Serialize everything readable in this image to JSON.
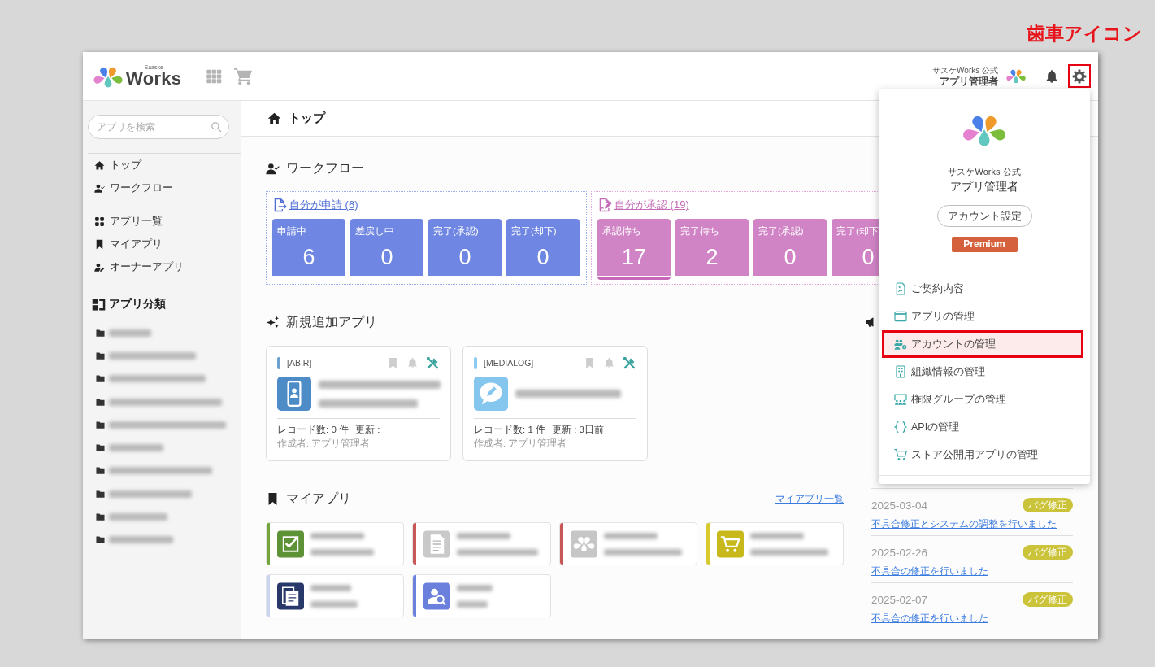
{
  "annotation": {
    "label": "歯車アイコン"
  },
  "header": {
    "logo": {
      "small": "Saaske",
      "name": "Works"
    },
    "account": {
      "org": "サスケWorks 公式",
      "role": "アプリ管理者"
    },
    "settings_button": {
      "annotated": true
    }
  },
  "sidebar": {
    "search": {
      "placeholder": "アプリを検索"
    },
    "nav_groups": [
      {
        "items": [
          {
            "kind": "home",
            "label": "トップ"
          },
          {
            "kind": "workflow",
            "label": "ワークフロー"
          }
        ]
      },
      {
        "items": [
          {
            "kind": "apps",
            "label": "アプリ一覧"
          },
          {
            "kind": "bookmark",
            "label": "マイアプリ"
          },
          {
            "kind": "owner",
            "label": "オーナーアプリ"
          }
        ]
      }
    ],
    "categories": {
      "title": "アプリ分類",
      "items": [
        {
          "kind": "folder"
        },
        {
          "kind": "folder"
        },
        {
          "kind": "folder"
        },
        {
          "kind": "folder"
        },
        {
          "kind": "folder"
        },
        {
          "kind": "folder"
        },
        {
          "kind": "folder"
        },
        {
          "kind": "folder"
        },
        {
          "kind": "folder"
        },
        {
          "kind": "folder"
        }
      ]
    }
  },
  "page_title": "トップ",
  "workflow": {
    "title": "ワークフロー",
    "groups": [
      {
        "kind": "request",
        "link": "自分が申請 (6)",
        "tiles": [
          {
            "label": "申請中",
            "value": "6",
            "selected": false
          },
          {
            "label": "差戻し中",
            "value": "0",
            "selected": false
          },
          {
            "label": "完了(承認)",
            "value": "0",
            "selected": false
          },
          {
            "label": "完了(却下)",
            "value": "0",
            "selected": false
          }
        ]
      },
      {
        "kind": "approve",
        "link": "自分が承認 (19)",
        "tiles": [
          {
            "label": "承認待ち",
            "value": "17",
            "selected": true
          },
          {
            "label": "完了待ち",
            "value": "2",
            "selected": false
          },
          {
            "label": "完了(承認)",
            "value": "0",
            "selected": false
          },
          {
            "label": "完了(却下",
            "value": "0",
            "selected": false
          }
        ]
      }
    ]
  },
  "new_apps": {
    "title": "新規追加アプリ",
    "cards": [
      {
        "code": "[ABIR]",
        "color": "#6d9fcf",
        "kind": "phone",
        "records": "レコード数: 0 件",
        "updated": "更新 :",
        "creator": "作成者: アプリ管理者"
      },
      {
        "code": "[MEDIALOG]",
        "color": "#8ccbf2",
        "kind": "chat",
        "records": "レコード数: 1 件",
        "updated": "更新 : 3日前",
        "creator": "作成者: アプリ管理者"
      }
    ]
  },
  "my_apps": {
    "title": "マイアプリ",
    "link": "マイアプリ一覧",
    "tiles": [
      {
        "kind": "check",
        "color": "#72a63c"
      },
      {
        "kind": "document",
        "color": "#c95757"
      },
      {
        "kind": "logo",
        "color": "#c95757"
      },
      {
        "kind": "cart",
        "color": "#d6ca2e"
      },
      {
        "kind": "copy",
        "color": "#c9d3f2"
      },
      {
        "kind": "search",
        "color": "#6a82de"
      }
    ]
  },
  "news": {
    "items": [
      {
        "date": "2025-03-04",
        "tag": "バグ修正",
        "title": "不具合修正とシステムの調整を行いました"
      },
      {
        "date": "2025-02-26",
        "tag": "バグ修正",
        "title": "不具合の修正を行いました"
      },
      {
        "date": "2025-02-07",
        "tag": "バグ修正",
        "title": "不具合の修正を行いました"
      }
    ]
  },
  "account_menu": {
    "org": "サスケWorks 公式",
    "role": "アプリ管理者",
    "settings_button": "アカウント設定",
    "plan": "Premium",
    "items": [
      {
        "kind": "contract",
        "label": "ご契約内容",
        "highlighted": false,
        "annotated": false
      },
      {
        "kind": "window",
        "label": "アプリの管理",
        "highlighted": false,
        "annotated": false
      },
      {
        "kind": "accounts",
        "label": "アカウントの管理",
        "highlighted": true,
        "annotated": true
      },
      {
        "kind": "org",
        "label": "組織情報の管理",
        "highlighted": false,
        "annotated": false
      },
      {
        "kind": "groups",
        "label": "権限グループの管理",
        "highlighted": false,
        "annotated": false
      },
      {
        "kind": "api",
        "label": "APIの管理",
        "highlighted": false,
        "annotated": false
      },
      {
        "kind": "store",
        "label": "ストア公開用アプリの管理",
        "highlighted": false,
        "annotated": false
      }
    ]
  }
}
